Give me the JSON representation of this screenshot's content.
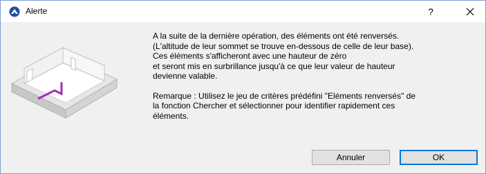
{
  "window": {
    "title": "Alerte",
    "help_label": "?",
    "icon": "archicad-logo-icon"
  },
  "message": {
    "para1_lines": [
      "A la suite de la dernière opération, des éléments ont été renversés.",
      "(L'altitude de leur sommet se trouve en-dessous de celle de leur base).",
      "Ces éléments s'afficheront avec une hauteur de zéro",
      "et seront mis en surbrillance jusqu'à ce que leur valeur de hauteur",
      "devienne valable."
    ],
    "para2_lines": [
      "Remarque : Utilisez le jeu de critères prédéfini \"Eléments renversés\" de",
      "la fonction Chercher et sélectionner pour identifier rapidement ces",
      "éléments."
    ]
  },
  "buttons": {
    "cancel_label": "Annuler",
    "ok_label": "OK"
  },
  "colors": {
    "accent": "#0078d7",
    "highlight": "#9b30b8"
  }
}
